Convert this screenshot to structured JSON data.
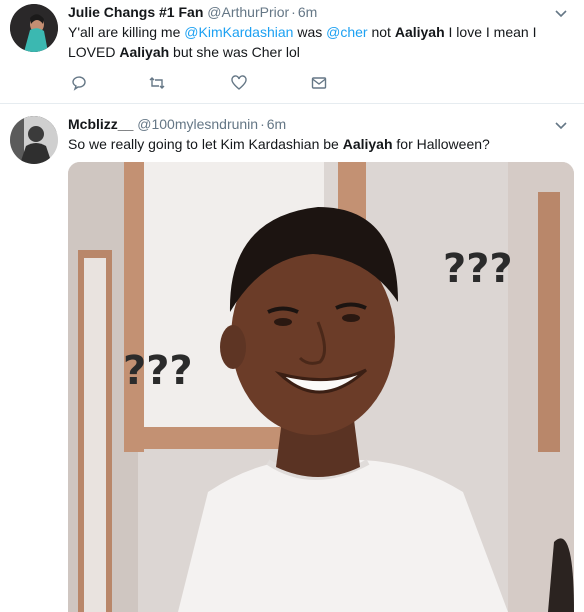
{
  "tweets": [
    {
      "display_name": "Julie Changs #1 Fan",
      "handle": "@ArthurPrior",
      "separator": "·",
      "time": "6m",
      "text_parts": {
        "a": "Y'all are killing me ",
        "b": "@KimKardashian",
        "c": " was ",
        "d": "@cher",
        "e": " not ",
        "f": "Aaliyah",
        "g": " I love I mean I LOVED ",
        "h": "Aaliyah",
        "i": " but she was Cher lol"
      },
      "actions": [
        "reply-icon",
        "retweet-icon",
        "like-icon",
        "message-icon"
      ]
    },
    {
      "display_name": "Mcblizz__",
      "handle": "@100mylesndrunin",
      "separator": "·",
      "time": "6m",
      "text_parts": {
        "a": "So we really going to let Kim Kardashian be ",
        "b": "Aaliyah",
        "c": " for Halloween?"
      },
      "media": {
        "alt_marks_left": "???",
        "alt_marks_right": "???"
      }
    }
  ],
  "colors": {
    "link": "#1da1f2",
    "secondary_text": "#657786",
    "divider": "#e6ecf0"
  }
}
